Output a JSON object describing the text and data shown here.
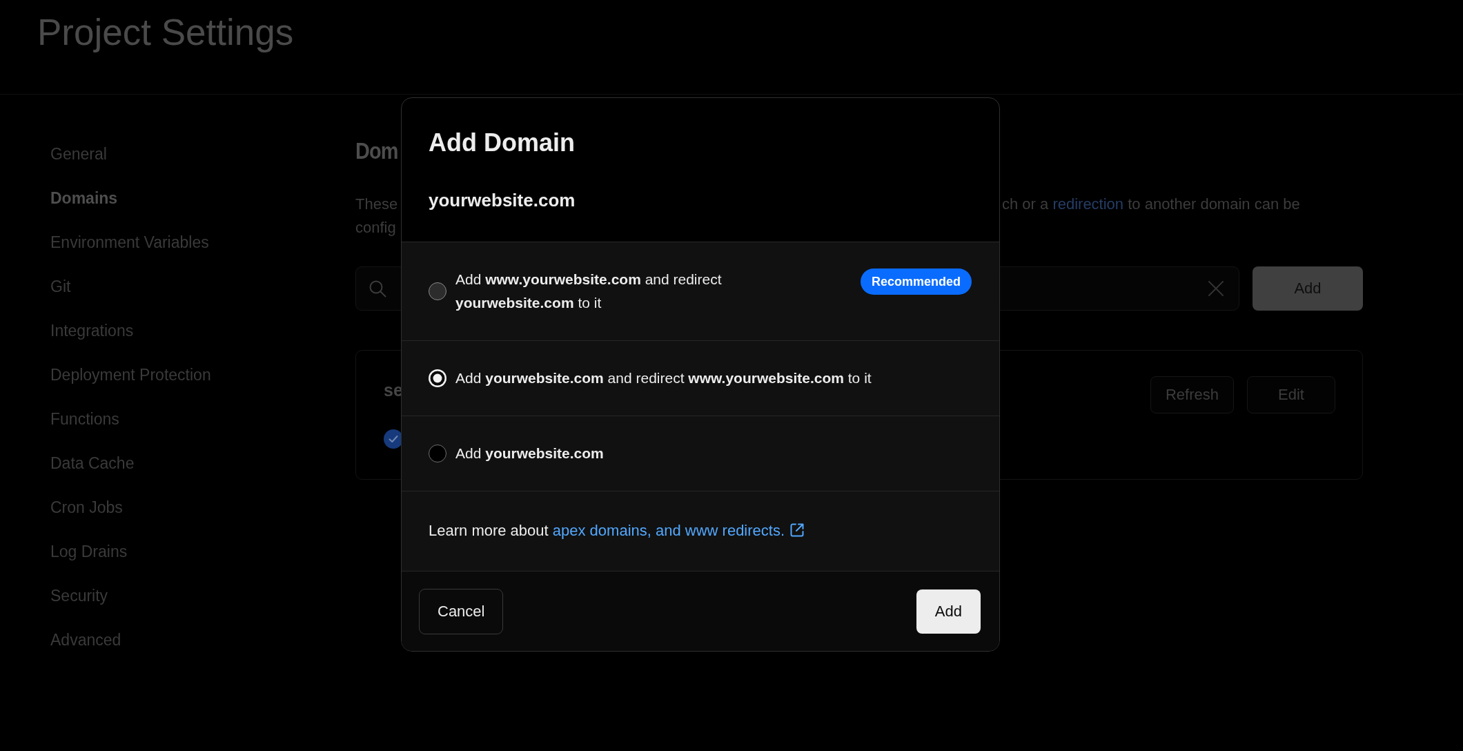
{
  "header": {
    "title": "Project Settings"
  },
  "sidebar": {
    "items": [
      {
        "label": "General",
        "selected": false
      },
      {
        "label": "Domains",
        "selected": true
      },
      {
        "label": "Environment Variables",
        "selected": false
      },
      {
        "label": "Git",
        "selected": false
      },
      {
        "label": "Integrations",
        "selected": false
      },
      {
        "label": "Deployment Protection",
        "selected": false
      },
      {
        "label": "Functions",
        "selected": false
      },
      {
        "label": "Data Cache",
        "selected": false
      },
      {
        "label": "Cron Jobs",
        "selected": false
      },
      {
        "label": "Log Drains",
        "selected": false
      },
      {
        "label": "Security",
        "selected": false
      },
      {
        "label": "Advanced",
        "selected": false
      }
    ]
  },
  "main": {
    "heading": "Dom",
    "description": {
      "lines": [
        {
          "left": "These",
          "right": {
            "text_before": "ch or a",
            "link": "redirection",
            "text_after": "to another domain can be"
          }
        },
        {
          "left": "config"
        }
      ]
    },
    "add_button": "Add",
    "domain_card": {
      "name": "se",
      "buttons": [
        "Refresh",
        "Edit"
      ]
    }
  },
  "modal": {
    "title": "Add Domain",
    "domain": "yourwebsite.com",
    "options": [
      {
        "label": "Add **www.yourwebsite.com** and redirect **yourwebsite.com** to it",
        "badge": "Recommended",
        "selected": false,
        "hovered": true
      },
      {
        "label": "Add **yourwebsite.com** and redirect **www.yourwebsite.com** to it",
        "selected": true,
        "hovered": false
      },
      {
        "label": "Add **yourwebsite.com**",
        "selected": false,
        "hovered": false
      }
    ],
    "learn_more": {
      "text": "Learn more about",
      "link": "apex domains, and www redirects."
    },
    "buttons": {
      "cancel": "Cancel",
      "confirm": "Add"
    }
  }
}
